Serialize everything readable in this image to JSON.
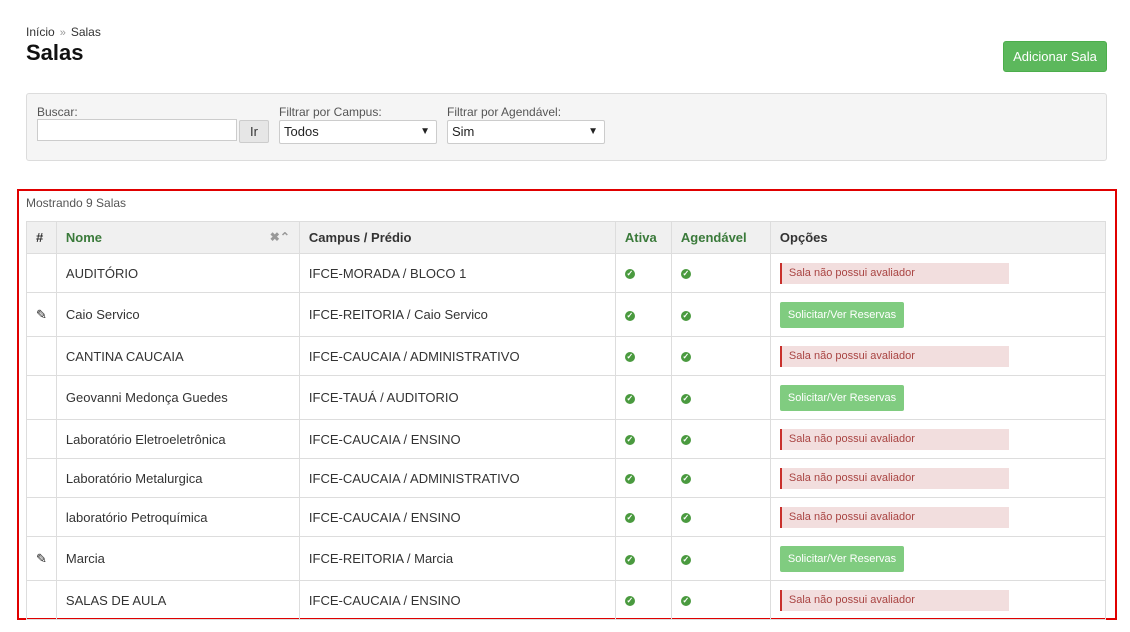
{
  "breadcrumb": {
    "home": "Início",
    "sep": "»",
    "current": "Salas"
  },
  "page": {
    "title": "Salas",
    "add_button": "Adicionar Sala"
  },
  "filters": {
    "search_label": "Buscar:",
    "search_value": "",
    "go_button": "Ir",
    "campus_label": "Filtrar por Campus:",
    "campus_value": "Todos",
    "schedulable_label": "Filtrar por Agendável:",
    "schedulable_value": "Sim"
  },
  "table": {
    "showing": "Mostrando 9 Salas",
    "headers": {
      "num": "#",
      "name": "Nome",
      "campus": "Campus / Prédio",
      "active": "Ativa",
      "schedulable": "Agendável",
      "options": "Opções"
    },
    "no_evaluator_label": "Sala não possui avaliador",
    "request_label": "Solicitar/Ver Reservas",
    "rows": [
      {
        "name": "AUDITÓRIO",
        "campus": "IFCE-MORADA / BLOCO 1"
      },
      {
        "name": "Caio Servico",
        "campus": "IFCE-REITORIA / Caio Servico"
      },
      {
        "name": "CANTINA CAUCAIA",
        "campus": "IFCE-CAUCAIA / ADMINISTRATIVO"
      },
      {
        "name": "Geovanni Medonça Guedes",
        "campus": "IFCE-TAUÁ / AUDITORIO"
      },
      {
        "name": "Laboratório Eletroeletrônica",
        "campus": "IFCE-CAUCAIA / ENSINO"
      },
      {
        "name": "Laboratório Metalurgica",
        "campus": "IFCE-CAUCAIA / ADMINISTRATIVO"
      },
      {
        "name": "laboratório Petroquímica",
        "campus": "IFCE-CAUCAIA / ENSINO"
      },
      {
        "name": "Marcia",
        "campus": "IFCE-REITORIA / Marcia"
      },
      {
        "name": "SALAS DE AULA",
        "campus": "IFCE-CAUCAIA / ENSINO"
      }
    ]
  },
  "colors": {
    "accent_green": "#5cb85c",
    "header_green": "#3a7a3a",
    "alert_red": "#a94442",
    "highlight_red": "#e00000"
  }
}
